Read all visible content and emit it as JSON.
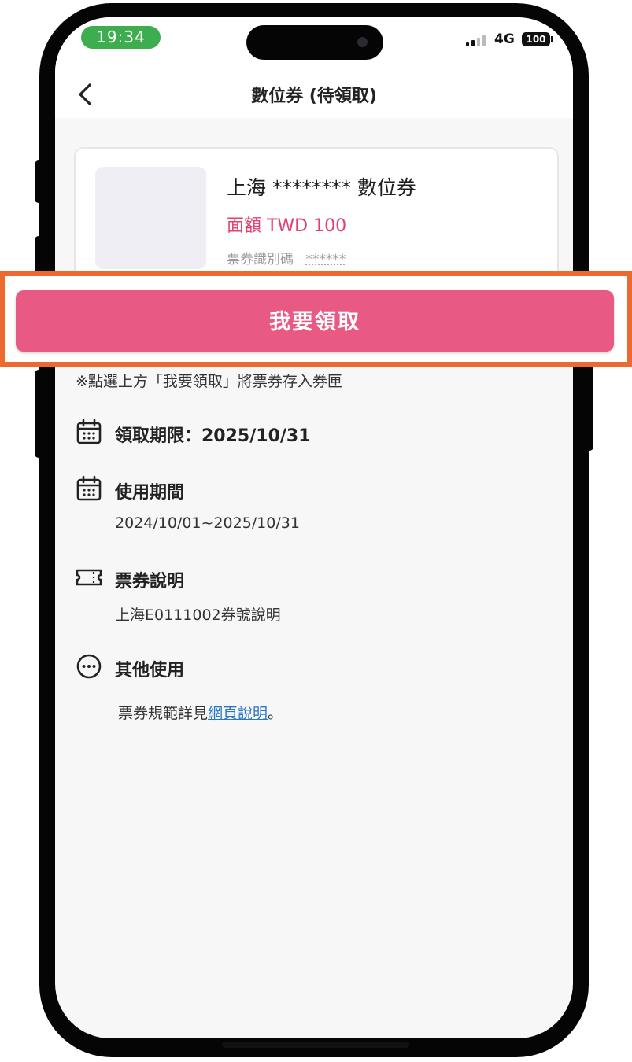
{
  "status_bar": {
    "time": "19:34",
    "network": "4G",
    "battery": "100"
  },
  "header": {
    "title": "數位券 (待領取)",
    "back_icon": "chevron-left-icon"
  },
  "voucher": {
    "name": "上海 ******** 數位券",
    "amount": "面額 TWD 100",
    "code_label": "票券識別碼",
    "code_value": "******"
  },
  "claim_button": {
    "label": "我要領取"
  },
  "notice": "※點選上方「我要領取」將票券存入券匣",
  "sections": {
    "claim_deadline": {
      "icon": "calendar-icon",
      "heading": "領取期限：2025/10/31"
    },
    "usage_period": {
      "icon": "calendar-icon",
      "heading": "使用期間",
      "body": "2024/10/01~2025/10/31"
    },
    "ticket_description": {
      "icon": "ticket-icon",
      "heading": "票券說明",
      "body": "上海E0111002券號說明"
    },
    "other_usage": {
      "icon": "more-icon",
      "heading": "其他使用",
      "body_prefix": "票券規範詳見",
      "link": "網頁說明",
      "body_suffix": "。"
    }
  },
  "colors": {
    "accent_pink": "#e85a84",
    "amount_pink": "#e2406f",
    "highlight_orange": "#ec6a2f",
    "time_pill_green": "#3ead4f",
    "link_blue": "#2a76c8"
  }
}
